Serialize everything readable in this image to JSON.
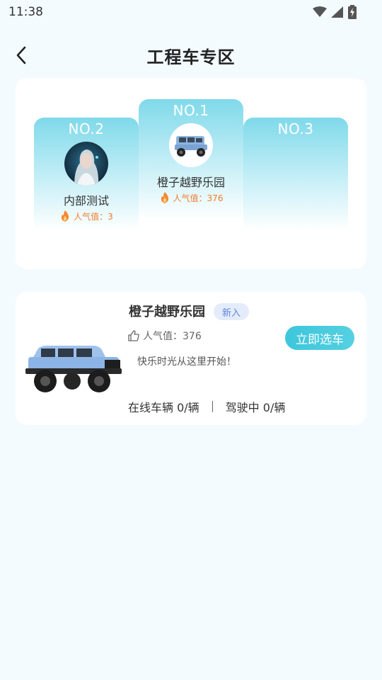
{
  "status_bar": {
    "time": "11:38"
  },
  "header": {
    "title": "工程车专区"
  },
  "ranking": {
    "first": {
      "rank_label": "NO.1",
      "name": "橙子越野乐园",
      "popularity": "人气值：376"
    },
    "second": {
      "rank_label": "NO.2",
      "name": "内部测试",
      "popularity": "人气值：3"
    },
    "third": {
      "rank_label": "NO.3"
    }
  },
  "store": {
    "name": "橙子越野乐园",
    "badge": "新入",
    "likes": "人气值：376",
    "select_button": "立即选车",
    "slogan": "快乐时光从这里开始！",
    "online_vehicles": "在线车辆  0/辆",
    "driving": "驾驶中  0/辆"
  },
  "colors": {
    "accent": "#3dc6db",
    "popularity": "#f07c2a",
    "badge_bg": "#e4ecfb"
  }
}
